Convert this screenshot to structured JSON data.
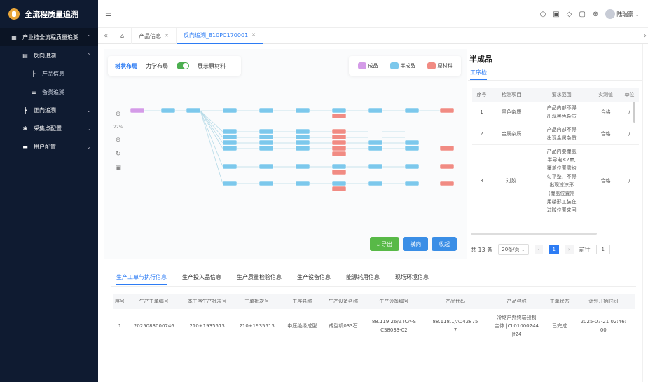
{
  "app": {
    "title": "全流程质量追溯"
  },
  "sidebar": {
    "items": [
      {
        "label": "产业链全流程质量追溯",
        "icon": "grid-icon",
        "level": 0,
        "expanded": true
      },
      {
        "label": "反向追溯",
        "icon": "document-icon",
        "level": 1,
        "expanded": true
      },
      {
        "label": "产品信息",
        "icon": "tree-icon",
        "level": 2
      },
      {
        "label": "备货追溯",
        "icon": "list-icon",
        "level": 2
      },
      {
        "label": "正向追溯",
        "icon": "tree-icon",
        "level": 1,
        "expanded": false
      },
      {
        "label": "采集点配置",
        "icon": "gear-icon",
        "level": 1,
        "expanded": false
      },
      {
        "label": "用户配置",
        "icon": "user-config-icon",
        "level": 1,
        "expanded": false
      }
    ]
  },
  "topbar": {
    "username": "陆瑞豪"
  },
  "tabs": [
    {
      "label": "产品信息",
      "active": false
    },
    {
      "label": "反向追溯_810PC170001",
      "active": true
    }
  ],
  "graph": {
    "layout_tabs": [
      "树状布局",
      "力学布局"
    ],
    "switch_label": "展示原材料",
    "zoom": "22%",
    "legend": [
      {
        "label": "成品",
        "color": "#d49be8"
      },
      {
        "label": "半成品",
        "color": "#7cc8ec"
      },
      {
        "label": "原材料",
        "color": "#f18b83"
      }
    ],
    "buttons": {
      "export": "⤓ 导出",
      "horizontal": "横向",
      "collapse": "收起"
    }
  },
  "detail": {
    "title": "半成品",
    "tab": "工序检",
    "columns": [
      "序号",
      "检测项目",
      "要求范围",
      "实测值",
      "单位"
    ],
    "rows": [
      {
        "no": "1",
        "item": "黑色杂质",
        "req": [
          "产品内部不得",
          "出现黑色杂质"
        ],
        "val": "合格",
        "unit": "/"
      },
      {
        "no": "2",
        "item": "金属杂质",
        "req": [
          "产品内部不得",
          "出现金属杂质"
        ],
        "val": "合格",
        "unit": "/"
      },
      {
        "no": "3",
        "item": "过胶",
        "req": [
          "产品内要覆盖",
          "半导电≤2㎜,",
          "覆盖位置需均",
          "匀平整，不得",
          "出现凉凉形",
          "(覆盖位置需",
          "用楼形工装在",
          "过胶位置来回"
        ],
        "val": "合格",
        "unit": "/"
      }
    ],
    "pager": {
      "total": "共 13 条",
      "size": "20条/页",
      "page": "1",
      "goto": "前往",
      "goto_value": "1"
    }
  },
  "bottom": {
    "tabs": [
      "生产工单与执行信息",
      "生产投入品信息",
      "生产质量检验信息",
      "生产设备信息",
      "能源耗用信息",
      "现场环境信息"
    ],
    "columns": [
      "序号",
      "生产工单编号",
      "本工序生产批次号",
      "工单批次号",
      "工序名称",
      "生产设备名称",
      "生产设备编号",
      "产品代码",
      "产品名称",
      "工单状态",
      "计划开始时间"
    ],
    "rows": [
      {
        "cells": [
          [
            "1"
          ],
          [
            "2025083000746"
          ],
          [
            "210+1935513"
          ],
          [
            "210+1935513"
          ],
          [
            "中压绝缘成型"
          ],
          [
            "成型机033石"
          ],
          [
            "88.119.26/ZTCA-S",
            "CS8033-02"
          ],
          [
            "88.118.1/A042875",
            "7"
          ],
          [
            "冷缩户外终端预制",
            "主体 |CL01000244",
            "|f24"
          ],
          [
            "已完成"
          ],
          [
            "2025-07-21 02:46:",
            "00"
          ]
        ]
      }
    ]
  }
}
